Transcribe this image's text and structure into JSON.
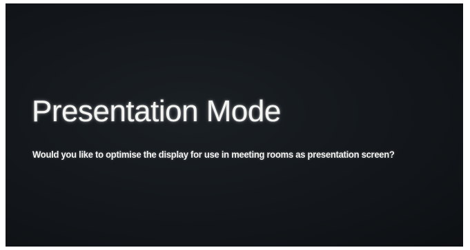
{
  "dialog": {
    "title": "Presentation Mode",
    "message": "Would you like to optimise the display for use in meeting rooms as presentation screen?"
  }
}
